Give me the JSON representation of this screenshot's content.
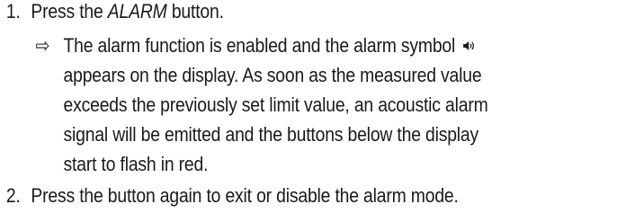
{
  "steps": [
    {
      "number": "1.",
      "text_before": "Press the ",
      "emphasis": "ALARM",
      "text_after": " button."
    },
    {
      "number": "2.",
      "text": "Press the button again to exit or disable the alarm mode."
    }
  ],
  "result": {
    "arrow": "⇨",
    "line1_before": "The alarm function is enabled and the alarm symbol",
    "icon": "alarm-sound-icon",
    "lines": [
      "appears on the display. As soon as the measured value",
      "exceeds the previously set limit value, an acoustic alarm",
      "signal will be emitted and the buttons below the display",
      "start to flash in red."
    ]
  }
}
